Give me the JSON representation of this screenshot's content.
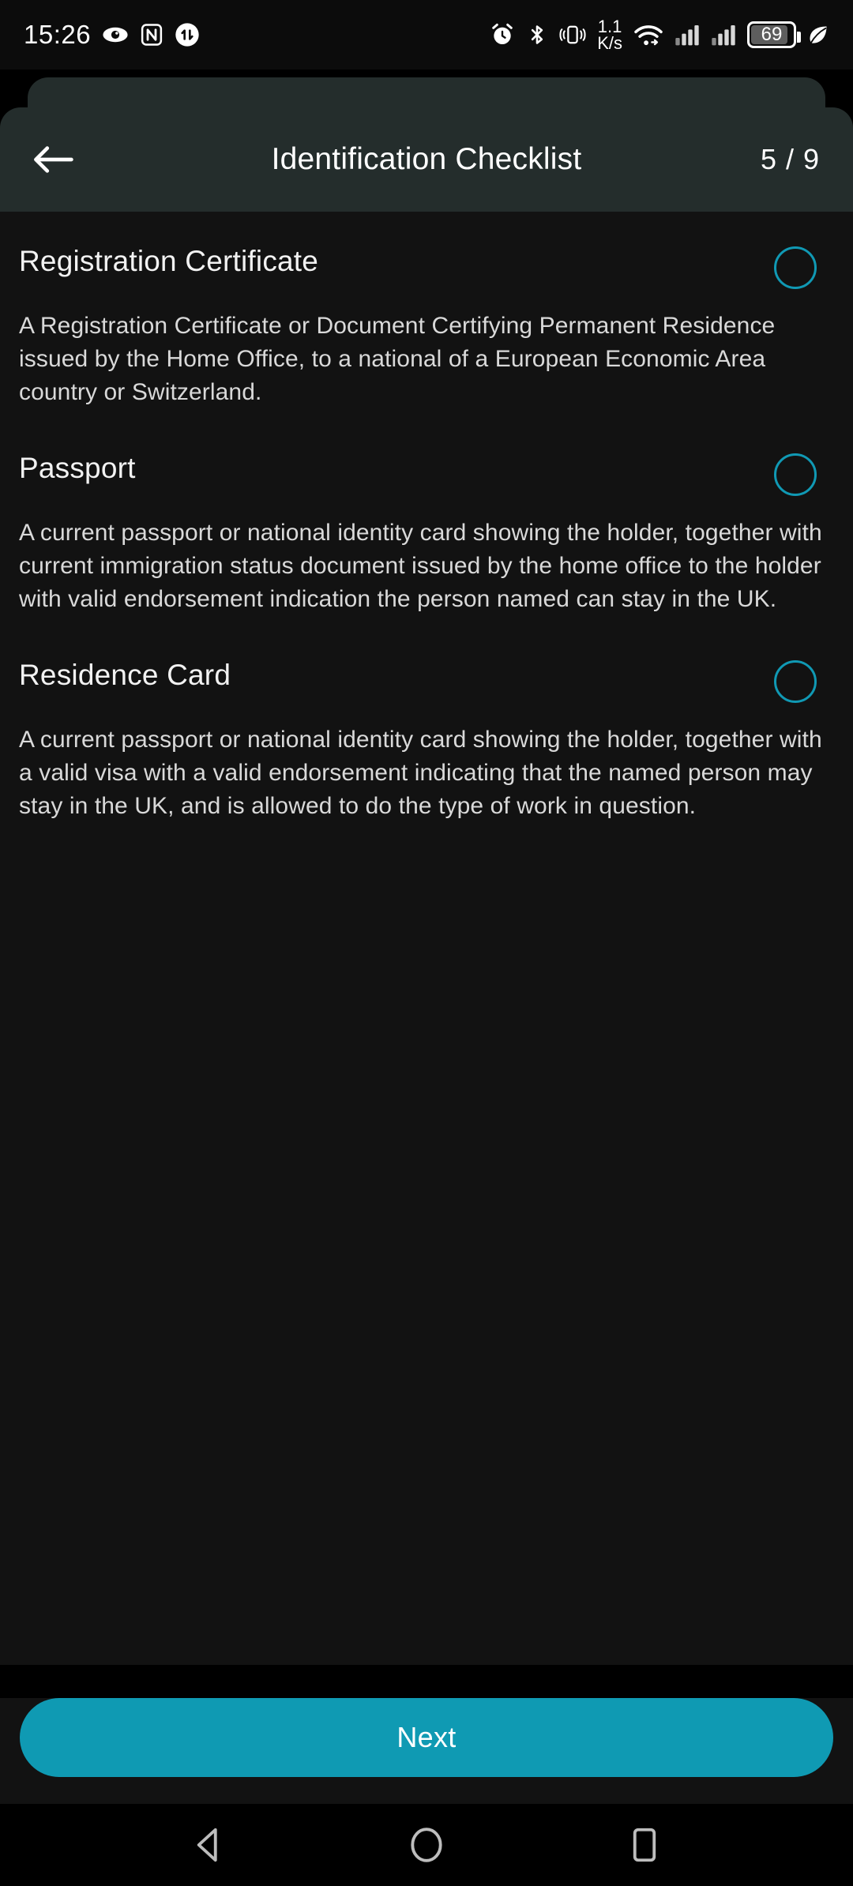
{
  "status_bar": {
    "time": "15:26",
    "network_speed_value": "1.1",
    "network_speed_unit": "K/s",
    "battery_percent": "69",
    "left_icons": [
      "eye-comfort-icon",
      "nfc-icon",
      "data-transfer-icon"
    ],
    "right_icons": [
      "alarm-icon",
      "bluetooth-icon",
      "vibrate-icon",
      "wifi-icon",
      "cellular-signal-1-icon",
      "cellular-signal-2-icon",
      "battery-icon",
      "power-saving-leaf-icon"
    ]
  },
  "app_bar": {
    "back_label": "back-arrow",
    "title": "Identification Checklist",
    "counter": "5 / 9"
  },
  "checklist": {
    "items": [
      {
        "title": "Registration Certificate",
        "description": "A Registration Certificate or Document Certifying Permanent Residence issued by the Home Office, to a national of a European Economic Area country or Switzerland.",
        "selected": false
      },
      {
        "title": "Passport",
        "description": "A current passport or national identity card showing the holder, together with current immigration status document issued by the home office to the holder with valid endorsement indication the person named can stay in the UK.",
        "selected": false
      },
      {
        "title": "Residence Card",
        "description": "A current passport or national identity card showing the holder, together with a valid visa with a valid endorsement indicating that the named person may stay in the UK, and is allowed to do the type of work in question.",
        "selected": false
      }
    ]
  },
  "footer": {
    "next_label": "Next"
  },
  "nav_bar": {
    "back": "nav-back-icon",
    "home": "nav-home-icon",
    "recents": "nav-recents-icon"
  },
  "colors": {
    "accent": "#0f9ab3",
    "radio_ring": "#1099b4",
    "appbar_bg": "#242d2c",
    "content_bg": "#121212",
    "text_primary": "#f2f2f2",
    "text_secondary": "#d9d9d9"
  }
}
